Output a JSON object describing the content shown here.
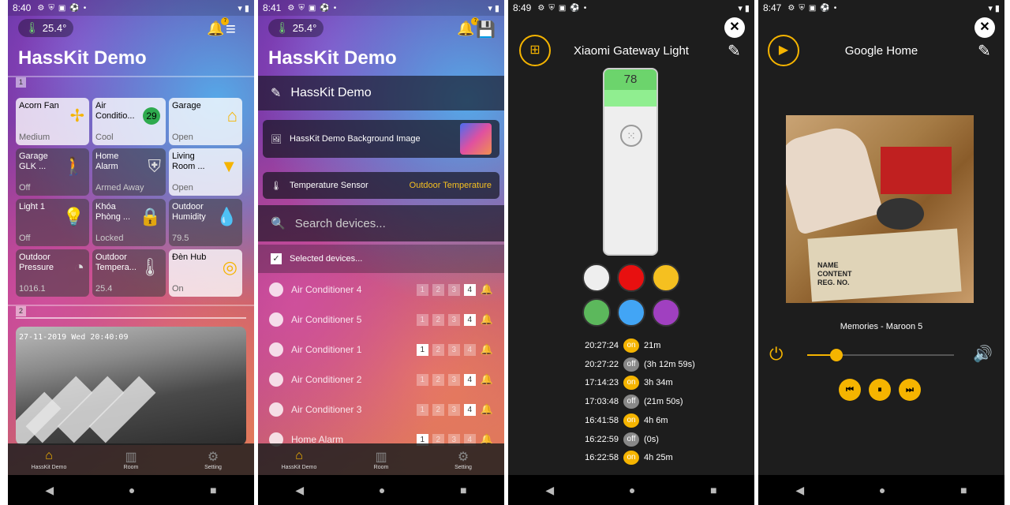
{
  "screen1": {
    "time": "8:40",
    "temp": "25.4°",
    "badge": "7",
    "title": "HassKit Demo",
    "group1": "1",
    "group2": "2",
    "tiles": [
      {
        "name": "Acorn Fan",
        "state": "Medium",
        "on": true,
        "icon": "fan-icon",
        "glyph": "✢"
      },
      {
        "name": "Air Conditio...",
        "state": "Cool",
        "on": true,
        "num": "29"
      },
      {
        "name": "Garage",
        "state": "Open",
        "on": true,
        "icon": "garage-icon",
        "glyph": "⌂"
      },
      {
        "name": "Garage GLK ...",
        "state": "Off",
        "on": false,
        "icon": "walk-icon",
        "glyph": "🚶"
      },
      {
        "name": "Home Alarm",
        "state": "Armed Away",
        "on": false,
        "icon": "shield-icon",
        "glyph": "⛨"
      },
      {
        "name": "Living Room ...",
        "state": "Open",
        "on": true,
        "icon": "lamp-icon",
        "glyph": "▼"
      },
      {
        "name": "Light 1",
        "state": "Off",
        "on": false,
        "icon": "bulb-icon",
        "glyph": "💡"
      },
      {
        "name": "Khóa Phòng ...",
        "state": "Locked",
        "on": false,
        "icon": "lock-icon",
        "glyph": "🔒"
      },
      {
        "name": "Outdoor Humidity",
        "state": "79.5",
        "on": false,
        "icon": "drop-icon",
        "glyph": "💧"
      },
      {
        "name": "Outdoor Pressure",
        "state": "1016.1",
        "on": false,
        "icon": "gauge-icon",
        "glyph": "◔"
      },
      {
        "name": "Outdoor Tempera...",
        "state": "25.4",
        "on": false,
        "icon": "thermometer-icon",
        "glyph": "🌡"
      },
      {
        "name": "Đèn Hub",
        "state": "On",
        "on": true,
        "icon": "hub-icon",
        "glyph": "◎"
      }
    ],
    "camera_stamp": "27-11-2019 Wed 20:40:09"
  },
  "screen2": {
    "time": "8:41",
    "temp": "25.4°",
    "badge": "7",
    "title": "HassKit Demo",
    "edit_title": "HassKit Demo",
    "bg_label": "HassKit Demo Background Image",
    "sensor_label": "Temperature Sensor",
    "sensor_value": "Outdoor Temperature",
    "search_placeholder": "Search devices...",
    "selected_label": "Selected devices...",
    "devices": [
      {
        "name": "Air Conditioner 4",
        "on": [
          false,
          false,
          false,
          true
        ]
      },
      {
        "name": "Air Conditioner 5",
        "on": [
          false,
          false,
          false,
          true
        ]
      },
      {
        "name": "Air Conditioner 1",
        "on": [
          true,
          false,
          false,
          false
        ]
      },
      {
        "name": "Air Conditioner 2",
        "on": [
          false,
          false,
          false,
          true
        ]
      },
      {
        "name": "Air Conditioner 3",
        "on": [
          false,
          false,
          false,
          true
        ]
      },
      {
        "name": "Home Alarm",
        "on": [
          true,
          false,
          false,
          false
        ]
      }
    ]
  },
  "screen3": {
    "time": "8:49",
    "title": "Xiaomi Gateway Light",
    "brightness": "78",
    "brightness_fraction": 0.78,
    "colors": [
      "#eeeeee",
      "#e81010",
      "#f5c020",
      "#5cb85c",
      "#42a5f5",
      "#a040c0"
    ],
    "log": [
      {
        "time": "20:27:24",
        "state": "on",
        "dur": "21m"
      },
      {
        "time": "20:27:22",
        "state": "off",
        "dur": "(3h 12m 59s)"
      },
      {
        "time": "17:14:23",
        "state": "on",
        "dur": "3h 34m"
      },
      {
        "time": "17:03:48",
        "state": "off",
        "dur": "(21m 50s)"
      },
      {
        "time": "16:41:58",
        "state": "on",
        "dur": "4h 6m"
      },
      {
        "time": "16:22:59",
        "state": "off",
        "dur": "(0s)"
      },
      {
        "time": "16:22:58",
        "state": "on",
        "dur": "4h 25m"
      }
    ]
  },
  "screen4": {
    "time": "8:47",
    "title": "Google Home",
    "track": "Memories  - Maroon 5",
    "volume_fraction": 0.2,
    "album_text": "NAME\nCONTENT\nREG. NO."
  },
  "tabs": [
    {
      "label": "HassKit Demo",
      "icon": "home-icon"
    },
    {
      "label": "Room",
      "icon": "room-icon"
    },
    {
      "label": "Setting",
      "icon": "gear-icon"
    }
  ]
}
